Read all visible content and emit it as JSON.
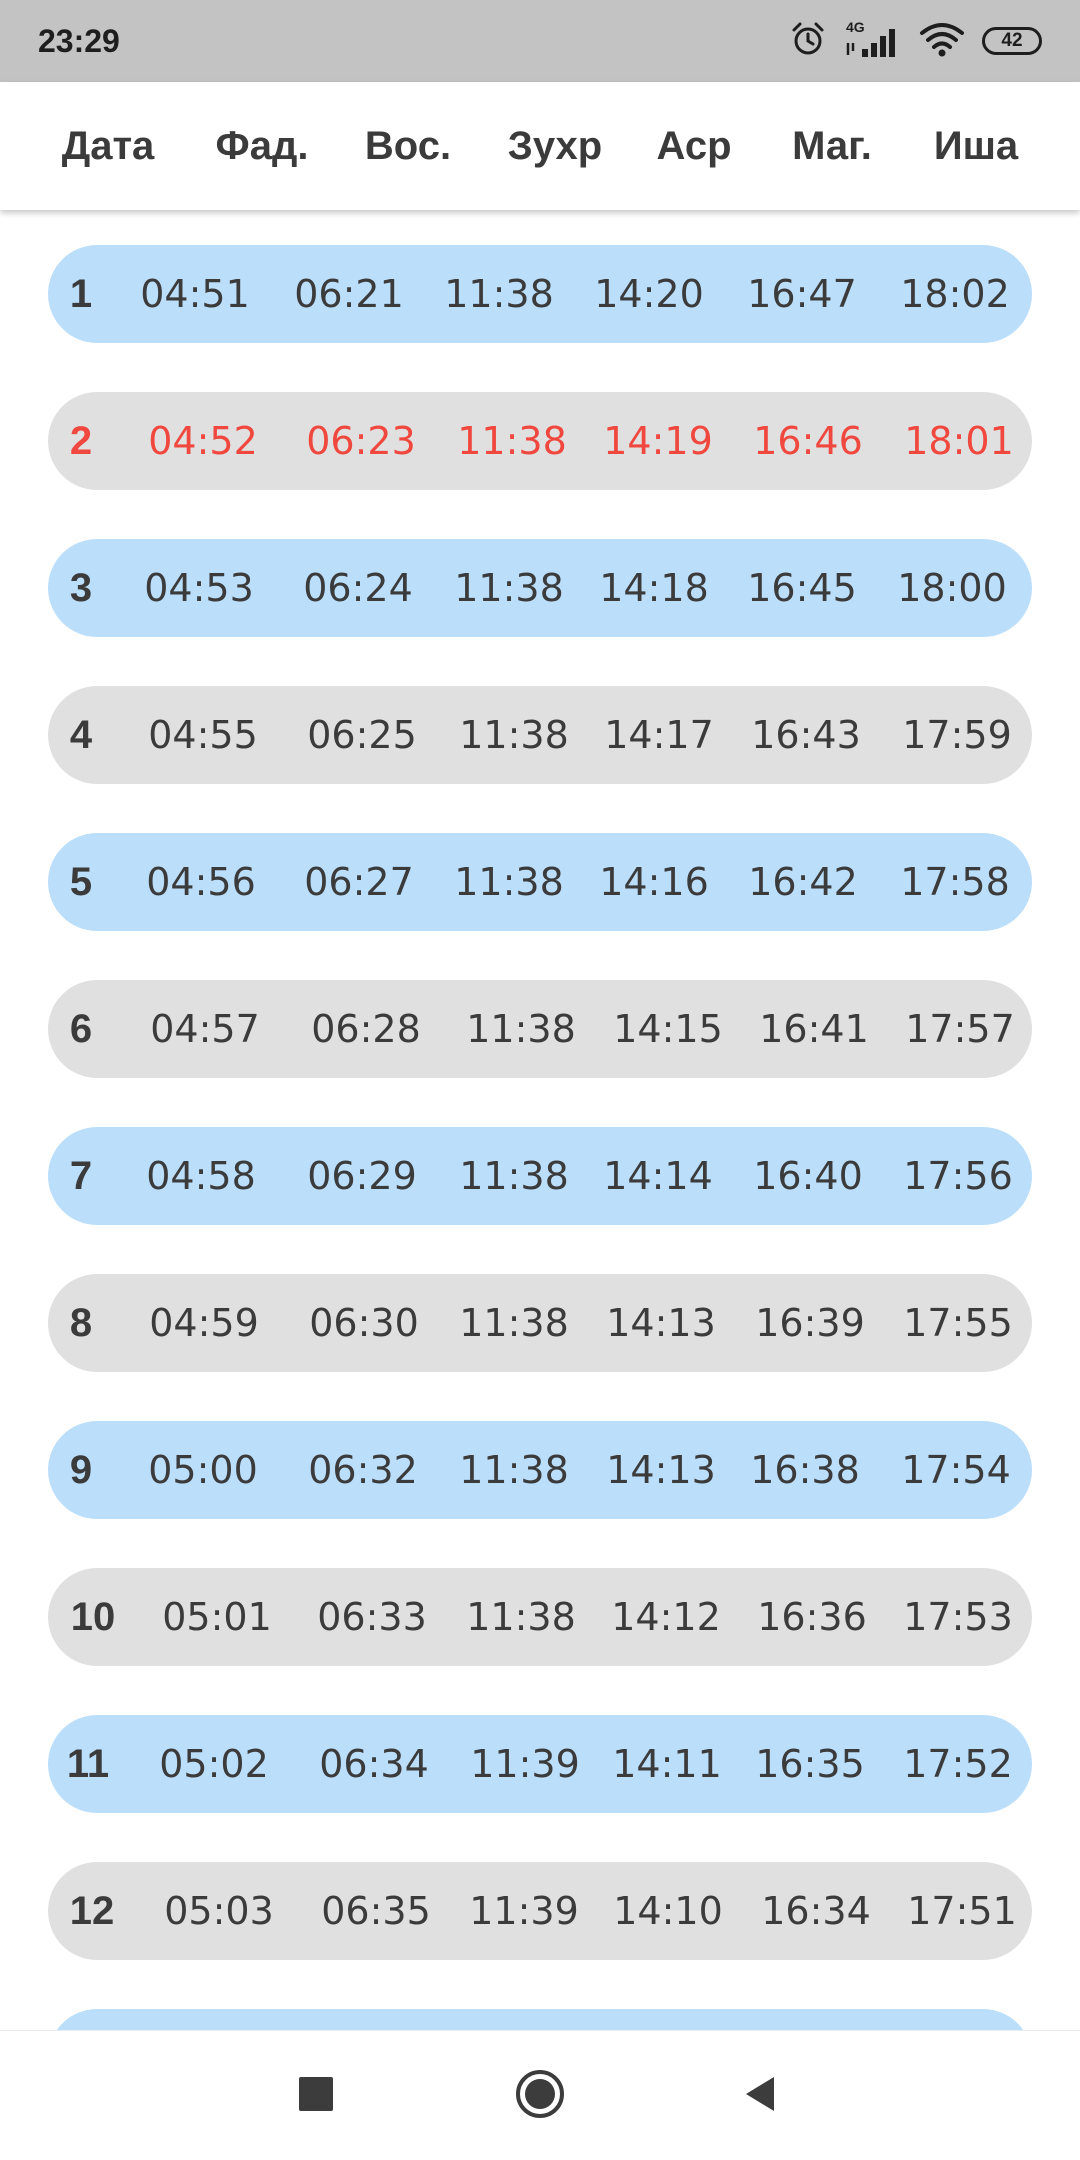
{
  "status_bar": {
    "time": "23:29",
    "network": "4G",
    "battery": "42",
    "icons": [
      "alarm-icon",
      "signal-icon",
      "wifi-icon",
      "battery-icon"
    ]
  },
  "header": {
    "columns": [
      "Дата",
      "Фад.",
      "Вос.",
      "Зухр",
      "Аср",
      "Маг.",
      "Иша"
    ]
  },
  "colors": {
    "row_blue": "#bbdefb",
    "row_gray": "#e0e0e0",
    "today_text": "#f0483e",
    "text": "#3b3b3b"
  },
  "rows": [
    {
      "day": "1",
      "times": [
        "04:51",
        "06:21",
        "11:38",
        "14:20",
        "16:47",
        "18:02"
      ]
    },
    {
      "day": "2",
      "times": [
        "04:52",
        "06:23",
        "11:38",
        "14:19",
        "16:46",
        "18:01"
      ],
      "today": true
    },
    {
      "day": "3",
      "times": [
        "04:53",
        "06:24",
        "11:38",
        "14:18",
        "16:45",
        "18:00"
      ]
    },
    {
      "day": "4",
      "times": [
        "04:55",
        "06:25",
        "11:38",
        "14:17",
        "16:43",
        "17:59"
      ]
    },
    {
      "day": "5",
      "times": [
        "04:56",
        "06:27",
        "11:38",
        "14:16",
        "16:42",
        "17:58"
      ]
    },
    {
      "day": "6",
      "times": [
        "04:57",
        "06:28",
        "11:38",
        "14:15",
        "16:41",
        "17:57"
      ]
    },
    {
      "day": "7",
      "times": [
        "04:58",
        "06:29",
        "11:38",
        "14:14",
        "16:40",
        "17:56"
      ]
    },
    {
      "day": "8",
      "times": [
        "04:59",
        "06:30",
        "11:38",
        "14:13",
        "16:39",
        "17:55"
      ]
    },
    {
      "day": "9",
      "times": [
        "05:00",
        "06:32",
        "11:38",
        "14:13",
        "16:38",
        "17:54"
      ]
    },
    {
      "day": "10",
      "times": [
        "05:01",
        "06:33",
        "11:38",
        "14:12",
        "16:36",
        "17:53"
      ]
    },
    {
      "day": "11",
      "times": [
        "05:02",
        "06:34",
        "11:39",
        "14:11",
        "16:35",
        "17:52"
      ]
    },
    {
      "day": "12",
      "times": [
        "05:03",
        "06:35",
        "11:39",
        "14:10",
        "16:34",
        "17:51"
      ]
    },
    {
      "day": "",
      "times": [
        "",
        "",
        "",
        "",
        "",
        ""
      ]
    }
  ],
  "nav": {
    "icons": [
      "recents-square-icon",
      "home-circle-icon",
      "back-triangle-icon"
    ]
  }
}
